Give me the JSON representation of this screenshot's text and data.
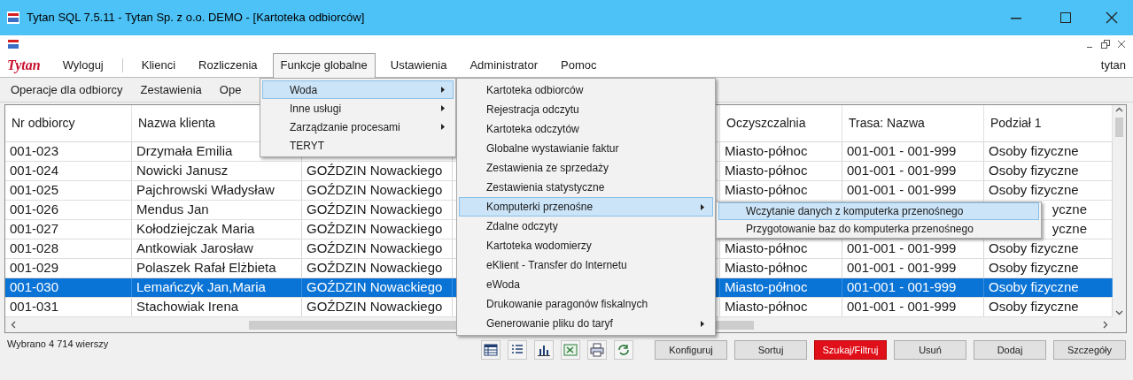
{
  "window": {
    "title": "Tytan SQL 7.5.11 - Tytan Sp. z o.o. DEMO  - [Kartoteka odbiorców]"
  },
  "menubar": {
    "logo": "Tytan",
    "user": "tytan",
    "items": [
      {
        "label": "Wyloguj",
        "selected": false
      },
      {
        "label": "Klienci",
        "selected": false
      },
      {
        "label": "Rozliczenia",
        "selected": false
      },
      {
        "label": "Funkcje globalne",
        "selected": true
      },
      {
        "label": "Ustawienia",
        "selected": false
      },
      {
        "label": "Administrator",
        "selected": false
      },
      {
        "label": "Pomoc",
        "selected": false
      }
    ]
  },
  "toolbar": [
    "Operacje dla odbiorcy",
    "Zestawienia",
    "Ope"
  ],
  "table": {
    "columns": [
      "Nr odbiorcy",
      "Nazwa klienta",
      null,
      null,
      "Oczyszczalnia",
      "Trasa: Nazwa",
      "Podział 1"
    ],
    "rows": [
      {
        "selected": false,
        "cells": [
          "001-023",
          "Drzymała Emilia",
          null,
          null,
          "Miasto-północ",
          "001-001 - 001-999",
          "Osoby fizyczne"
        ]
      },
      {
        "selected": false,
        "cells": [
          "001-024",
          "Nowicki Janusz",
          "GOŹDZIN Nowackiego",
          null,
          "Miasto-północ",
          "001-001 - 001-999",
          "Osoby fizyczne"
        ]
      },
      {
        "selected": false,
        "cells": [
          "001-025",
          "Pajchrowski Władysław",
          "GOŹDZIN Nowackiego",
          null,
          "Miasto-północ",
          "001-001 - 001-999",
          "Osoby fizyczne"
        ]
      },
      {
        "selected": false,
        "cells": [
          "001-026",
          "Mendus Jan",
          "GOŹDZIN Nowackiego",
          null,
          null,
          null,
          {
            "kind": "partial",
            "text": "yczne"
          }
        ]
      },
      {
        "selected": false,
        "cells": [
          "001-027",
          "Kołodziejczak Maria",
          "GOŹDZIN Nowackiego",
          null,
          null,
          null,
          {
            "kind": "partial",
            "text": "yczne"
          }
        ]
      },
      {
        "selected": false,
        "cells": [
          "001-028",
          "Antkowiak Jarosław",
          "GOŹDZIN Nowackiego",
          null,
          "Miasto-północ",
          "001-001 - 001-999",
          "Osoby fizyczne"
        ]
      },
      {
        "selected": false,
        "cells": [
          "001-029",
          "Polaszek Rafał Elżbieta",
          "GOŹDZIN Nowackiego",
          null,
          "Miasto-północ",
          "001-001 - 001-999",
          "Osoby fizyczne"
        ]
      },
      {
        "selected": true,
        "cells": [
          "001-030",
          "Lemańczyk Jan,Maria",
          "GOŹDZIN Nowackiego",
          null,
          "Miasto-północ",
          "001-001 - 001-999",
          "Osoby fizyczne"
        ]
      },
      {
        "selected": false,
        "cells": [
          "001-031",
          "Stachowiak Irena",
          "GOŹDZIN Nowackiego",
          null,
          "Miasto-północ",
          "001-001 - 001-999",
          "Osoby fizyczne"
        ]
      }
    ]
  },
  "status": "Wybrano 4 714 wierszy",
  "view_tools": [
    {
      "kind": "grid"
    },
    {
      "kind": "list"
    },
    {
      "kind": "chart"
    },
    {
      "kind": "spreadsheet"
    },
    {
      "kind": "print"
    },
    {
      "kind": "refresh"
    }
  ],
  "buttons": [
    {
      "label": "Konfiguruj",
      "kind": "normal"
    },
    {
      "label": "Sortuj",
      "kind": "normal"
    },
    {
      "label": "Szukaj/Filtruj",
      "kind": "alert"
    },
    {
      "label": "Usuń",
      "kind": "normal"
    },
    {
      "label": "Dodaj",
      "kind": "normal"
    },
    {
      "label": "Szczegóły",
      "kind": "normal"
    }
  ],
  "menus": [
    {
      "items": [
        {
          "label": "Woda",
          "selected": true,
          "submenu": true
        },
        {
          "label": "Inne usługi",
          "selected": false,
          "submenu": true
        },
        {
          "label": "Zarządzanie procesami",
          "selected": false,
          "submenu": true
        },
        {
          "label": "TERYT",
          "selected": false,
          "submenu": false
        }
      ]
    },
    {
      "items": [
        {
          "label": "Kartoteka odbiorców",
          "selected": false,
          "submenu": false
        },
        {
          "label": "Rejestracja odczytu",
          "selected": false,
          "submenu": false
        },
        {
          "label": "Kartoteka odczytów",
          "selected": false,
          "submenu": false
        },
        {
          "label": "Globalne wystawianie faktur",
          "selected": false,
          "submenu": false
        },
        {
          "label": "Zestawienia ze sprzedaży",
          "selected": false,
          "submenu": false
        },
        {
          "label": "Zestawienia statystyczne",
          "selected": false,
          "submenu": false
        },
        {
          "label": "Komputerki przenośne",
          "selected": true,
          "submenu": true
        },
        {
          "label": "Zdalne odczyty",
          "selected": false,
          "submenu": false
        },
        {
          "label": "Kartoteka wodomierzy",
          "selected": false,
          "submenu": false
        },
        {
          "label": "eKlient - Transfer do Internetu",
          "selected": false,
          "submenu": false
        },
        {
          "label": "eWoda",
          "selected": false,
          "submenu": false
        },
        {
          "label": "Drukowanie paragonów fiskalnych",
          "selected": false,
          "submenu": false
        },
        {
          "label": "Generowanie pliku do taryf",
          "selected": false,
          "submenu": true
        }
      ]
    },
    {
      "items": [
        {
          "label": "Wczytanie danych z komputerka przenośnego",
          "selected": true,
          "submenu": false
        },
        {
          "label": "Przygotowanie baz do komputerka przenośnego",
          "selected": false,
          "submenu": false
        }
      ]
    }
  ]
}
